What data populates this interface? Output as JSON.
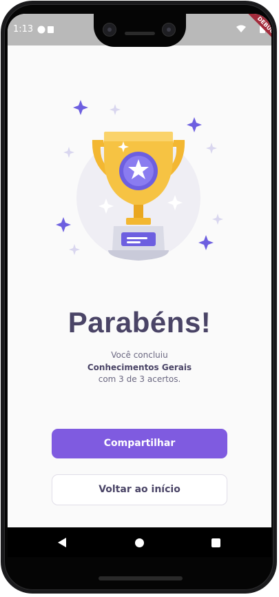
{
  "status": {
    "time": "1:13",
    "debug": "DEBUG"
  },
  "result": {
    "title": "Parabéns!",
    "line1": "Você concluiu",
    "topic": "Conhecimentos Gerais",
    "score": "com 3 de 3 acertos."
  },
  "actions": {
    "share": "Compartilhar",
    "home": "Voltar ao início"
  },
  "colors": {
    "accent": "#7f5be0",
    "title": "#4a4466",
    "trophy": "#f6c343"
  }
}
